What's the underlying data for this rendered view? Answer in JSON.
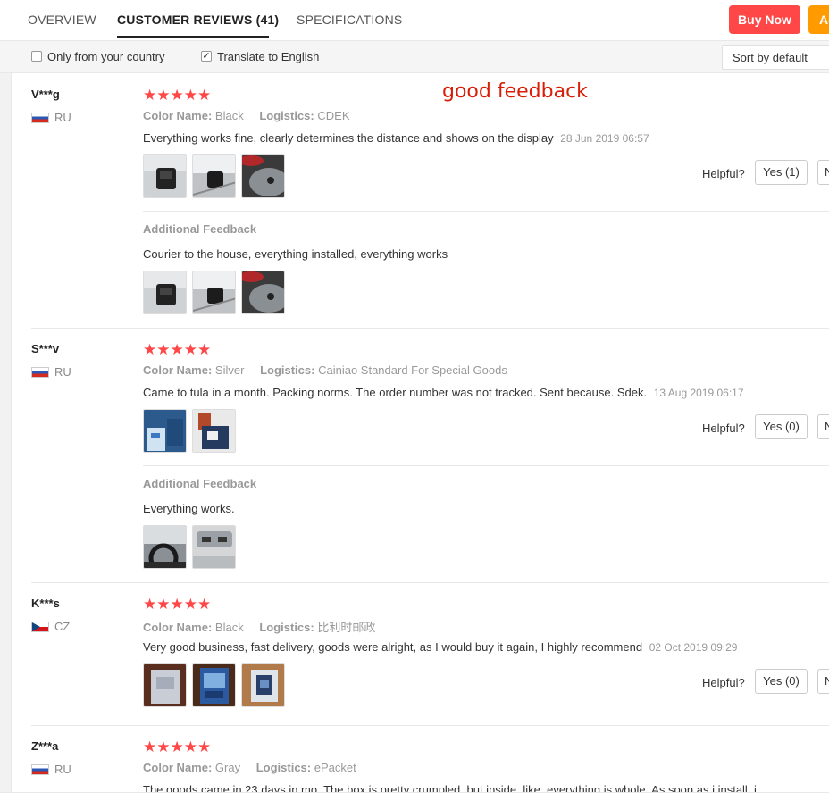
{
  "tabs": [
    {
      "label": "OVERVIEW",
      "active": false
    },
    {
      "label": "CUSTOMER REVIEWS (41)",
      "active": true
    },
    {
      "label": "SPECIFICATIONS",
      "active": false
    }
  ],
  "actions": {
    "buy_now": "Buy Now",
    "add_cart": "Ad"
  },
  "filters": {
    "only_country": {
      "label": "Only from your country",
      "checked": false
    },
    "translate": {
      "label": "Translate to English",
      "checked": true
    },
    "sort": "Sort by default"
  },
  "annotation": "good feedback",
  "labels": {
    "color_name": "Color Name:",
    "logistics": "Logistics:",
    "helpful": "Helpful?",
    "additional": "Additional Feedback",
    "stars": "★★★★★"
  },
  "reviews": [
    {
      "user": "V***g",
      "country": "RU",
      "rating": 5,
      "color": "Black",
      "logistics": "CDEK",
      "text": "Everything works fine, clearly determines the distance and shows on the display",
      "date": "28 Jun 2019 06:57",
      "yes": "Yes (1)",
      "no": "No",
      "additional_text": "Courier to the house, everything installed, everything works"
    },
    {
      "user": "S***v",
      "country": "RU",
      "rating": 5,
      "color": "Silver",
      "logistics": "Cainiao Standard For Special Goods",
      "text": "Came to tula in a month. Packing norms. The order number was not tracked. Sent because. Sdek.",
      "date": "13 Aug 2019 06:17",
      "yes": "Yes (0)",
      "no": "No",
      "additional_text": "Everything works."
    },
    {
      "user": "K***s",
      "country": "CZ",
      "rating": 5,
      "color": "Black",
      "logistics": "比利时邮政",
      "text": "Very good business, fast delivery, goods were alright, as I would buy it again, I highly recommend",
      "date": "02 Oct 2019 09:29",
      "yes": "Yes (0)",
      "no": "No"
    },
    {
      "user": "Z***a",
      "country": "RU",
      "rating": 5,
      "color": "Gray",
      "logistics": "ePacket",
      "text": "The goods came in 23 days in mo. The box is pretty crumpled, but inside, like, everything is whole. As soon as i install, i"
    }
  ],
  "colors": {
    "accent_red": "#ff4747",
    "accent_orange": "#ff9a00",
    "annotation": "#d81e06"
  }
}
